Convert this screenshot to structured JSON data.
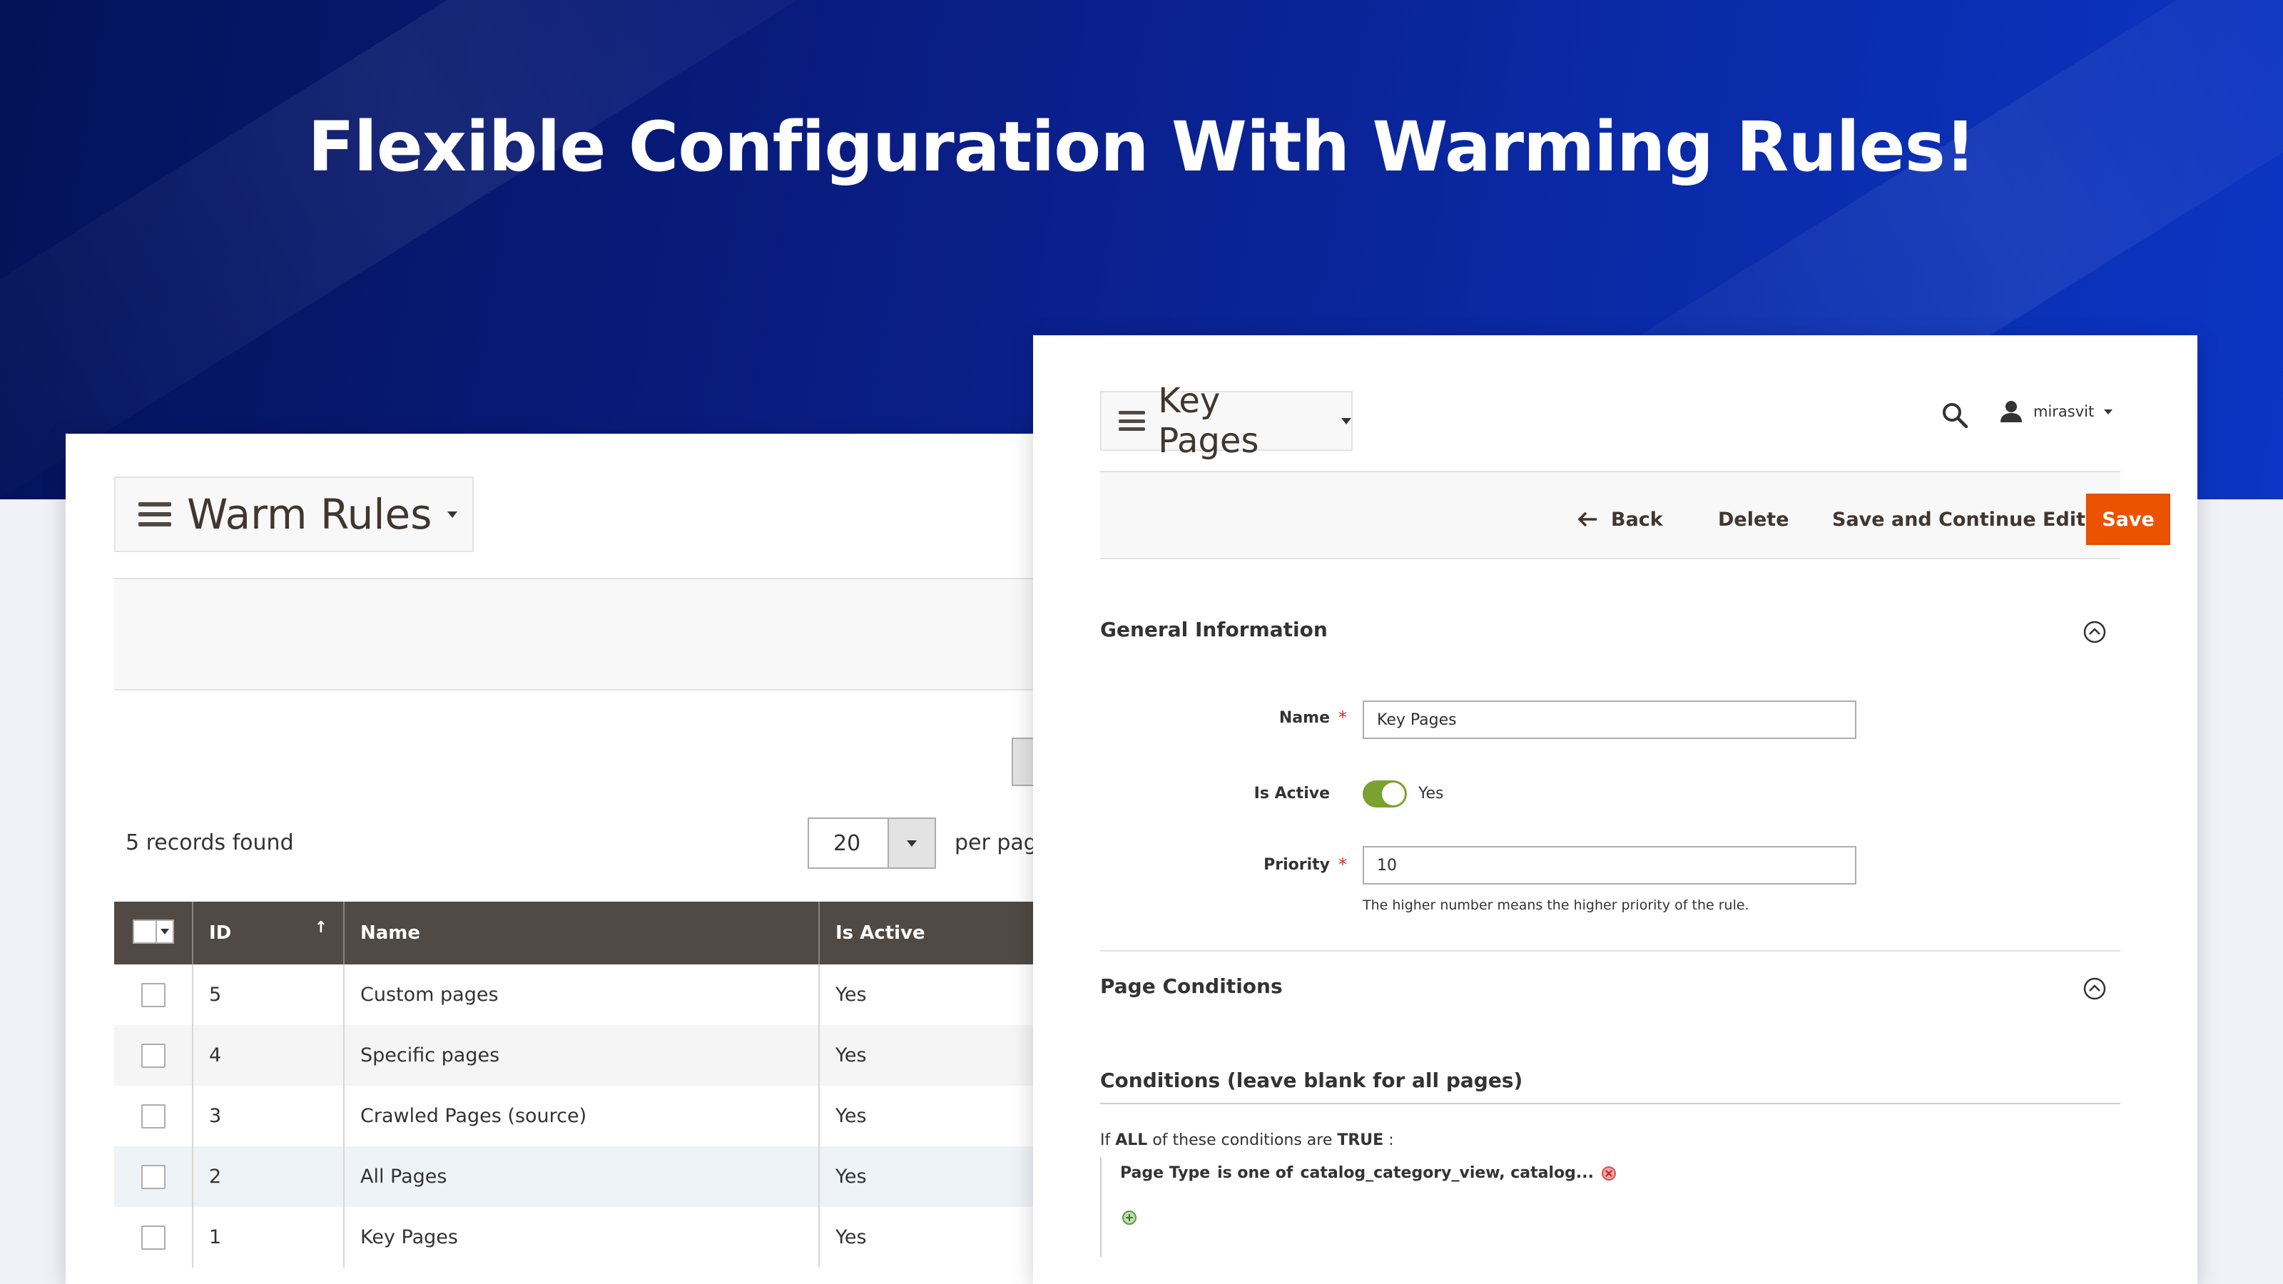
{
  "hero": {
    "title": "Flexible Configuration With Warming Rules!"
  },
  "left_panel": {
    "page_title": "Warm Rules",
    "records_found": "5 records found",
    "per_page_value": "20",
    "per_page_label": "per page",
    "columns": [
      "ID",
      "Name",
      "Is Active"
    ],
    "sort_indicator": "↑",
    "rows": [
      {
        "id": "5",
        "name": "Custom pages",
        "active": "Yes"
      },
      {
        "id": "4",
        "name": "Specific pages",
        "active": "Yes"
      },
      {
        "id": "3",
        "name": "Crawled Pages (source)",
        "active": "Yes"
      },
      {
        "id": "2",
        "name": "All Pages",
        "active": "Yes"
      },
      {
        "id": "1",
        "name": "Key Pages",
        "active": "Yes"
      }
    ]
  },
  "right_panel": {
    "page_title": "Key Pages",
    "user_name": "mirasvit",
    "actions": {
      "back": "Back",
      "delete": "Delete",
      "save_continue": "Save and Continue Edit",
      "save": "Save"
    },
    "general": {
      "title": "General Information",
      "name_label": "Name",
      "name_value": "Key Pages",
      "active_label": "Is Active",
      "active_value": "Yes",
      "priority_label": "Priority",
      "priority_value": "10",
      "priority_note": "The higher number means the higher priority of the rule."
    },
    "conditions": {
      "section_title": "Page Conditions",
      "heading": "Conditions (leave blank for all pages)",
      "prefix": "If",
      "aggregator": "ALL",
      "middle": "of these conditions are",
      "value": "TRUE",
      "suffix": ":",
      "rule_attribute": "Page Type",
      "rule_operator": "is one of",
      "rule_value": "catalog_category_view, catalog..."
    }
  },
  "colors": {
    "accent": "#eb5202",
    "grid_header": "#514943",
    "toggle_on": "#79a22e",
    "hero_start": "#041258",
    "hero_end": "#0b35c4"
  }
}
